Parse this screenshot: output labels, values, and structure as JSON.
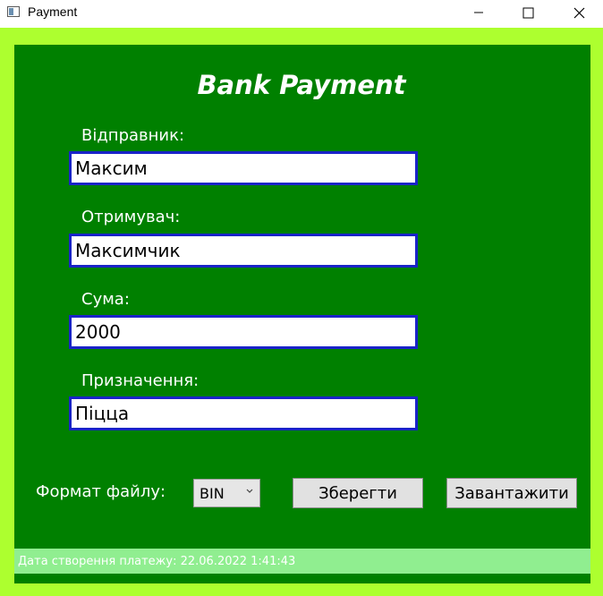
{
  "window": {
    "title": "Payment",
    "icon": "app-window-icon"
  },
  "form": {
    "heading": "Bank Payment",
    "sender_label": "Відправник:",
    "sender_value": "Максим",
    "recipient_label": "Отримувач:",
    "recipient_value": "Максимчик",
    "amount_label": "Сума:",
    "amount_value": "2000",
    "purpose_label": "Призначення:",
    "purpose_value": "Піцца"
  },
  "controls": {
    "format_label": "Формат файлу:",
    "format_selected": "BIN",
    "save_label": "Зберегти",
    "load_label": "Завантажити"
  },
  "status": {
    "text": "Дата створення платежу: 22.06.2022 1:41:43"
  },
  "colors": {
    "outer_bg": "#adff2f",
    "panel_bg": "#008000",
    "status_bg": "#90ee90",
    "input_border": "#1a23c8"
  }
}
